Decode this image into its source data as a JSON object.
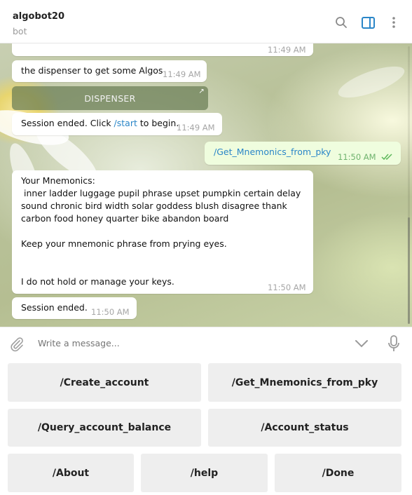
{
  "header": {
    "title": "algobot20",
    "subtitle": "bot",
    "icons": [
      "search-icon",
      "sidebar-toggle-icon",
      "more-vert-icon"
    ],
    "accent_color": "#2a86c8"
  },
  "messages": {
    "m0": {
      "time": "11:49 AM"
    },
    "m1": {
      "text": "the dispenser to get some Algos",
      "time": "11:49 AM"
    },
    "inline_button": {
      "label": "DISPENSER"
    },
    "m2": {
      "text_before": "Session ended. Click ",
      "link": "/start",
      "text_after": " to begin.",
      "time": "11:49 AM"
    },
    "m3": {
      "text": "/Get_Mnemonics_from_pky",
      "time": "11:50 AM",
      "status": "read"
    },
    "m4": {
      "line1": "Your Mnemonics:",
      "line2": " inner ladder luggage pupil phrase upset pumpkin certain delay",
      "line3": "sound chronic bird width solar goddess blush disagree thank",
      "line4": "carbon food honey quarter bike abandon board",
      "line5": "Keep your mnemonic phrase from prying eyes.",
      "line6": "I do not hold or manage your keys.",
      "time": "11:50 AM"
    },
    "m5": {
      "text": "Session ended.",
      "time": "11:50 AM"
    }
  },
  "compose": {
    "placeholder": "Write a message..."
  },
  "keyboard": {
    "row1": [
      "/Create_account",
      "/Get_Mnemonics_from_pky"
    ],
    "row2": [
      "/Query_account_balance",
      "/Account_status"
    ],
    "row3": [
      "/About",
      "/help",
      "/Done"
    ]
  }
}
